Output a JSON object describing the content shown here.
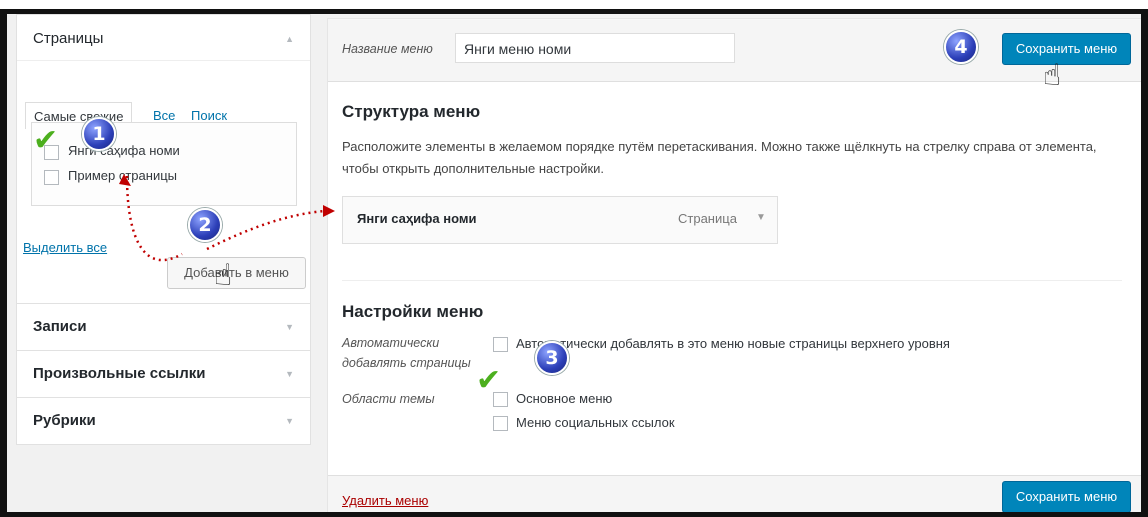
{
  "left": {
    "pages_panel": {
      "title": "Страницы",
      "tabs": [
        "Самые свежие",
        "Все",
        "Поиск"
      ],
      "items": [
        "Янги саҳифа номи",
        "Пример страницы"
      ],
      "select_all": "Выделить все",
      "add_button": "Добавить в меню"
    },
    "sections": [
      "Записи",
      "Произвольные ссылки",
      "Рубрики"
    ]
  },
  "header": {
    "menu_name_label": "Название меню",
    "menu_name_value": "Янги меню номи",
    "save_button": "Сохранить меню"
  },
  "structure": {
    "title": "Структура меню",
    "description": "Расположите элементы в желаемом порядке путём перетаскивания. Можно также щёлкнуть на стрелку справа от элемента, чтобы открыть дополнительные настройки.",
    "item_title": "Янги саҳифа номи",
    "item_type": "Страница"
  },
  "settings": {
    "title": "Настройки меню",
    "auto_label_line1": "Автоматически",
    "auto_label_line2": "добавлять страницы",
    "auto_option": "Автоматически добавлять в это меню новые страницы верхнего уровня",
    "theme_label": "Области темы",
    "theme_options": [
      "Основное меню",
      "Меню социальных ссылок"
    ]
  },
  "footer": {
    "delete_link": "Удалить меню",
    "save_button": "Сохранить меню"
  },
  "annotations": {
    "steps": [
      "1",
      "2",
      "3",
      "4"
    ],
    "colors": {
      "check": "#4caf1e",
      "badge": "#2c3fb8",
      "arrow": "#c00000",
      "primary": "#0085ba"
    }
  }
}
